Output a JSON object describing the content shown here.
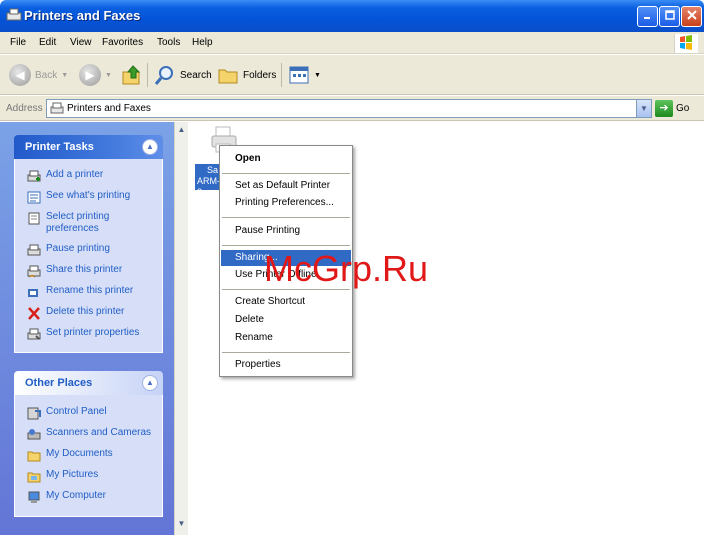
{
  "window": {
    "title": "Printers and Faxes"
  },
  "menu": [
    "File",
    "Edit",
    "View",
    "Favorites",
    "Tools",
    "Help"
  ],
  "toolbar": {
    "back": "Back",
    "search": "Search",
    "folders": "Folders"
  },
  "address": {
    "label": "Address",
    "value": "Printers and Faxes",
    "go": "Go"
  },
  "printer_tasks": {
    "title": "Printer Tasks",
    "items": [
      "Add a printer",
      "See what's printing",
      "Select printing preferences",
      "Pause printing",
      "Share this printer",
      "Rename this printer",
      "Delete this printer",
      "Set printer properties"
    ]
  },
  "other_places": {
    "title": "Other Places",
    "items": [
      "Control Panel",
      "Scanners and Cameras",
      "My Documents",
      "My Pictures",
      "My Computer"
    ]
  },
  "printer": {
    "label_line1": "Sa",
    "label_line2": "ARM-3"
  },
  "context_menu": {
    "open": "Open",
    "set_default": "Set as Default Printer",
    "preferences": "Printing Preferences...",
    "pause": "Pause Printing",
    "sharing": "Sharing...",
    "use_offline": "Use Printer Offline",
    "create_shortcut": "Create Shortcut",
    "delete": "Delete",
    "rename": "Rename",
    "properties": "Properties"
  },
  "watermark": "McGrp.Ru",
  "colors": {
    "titlebar": "#0553d8",
    "selection": "#316ac5",
    "task_link": "#215dc6",
    "watermark": "#e01818"
  }
}
